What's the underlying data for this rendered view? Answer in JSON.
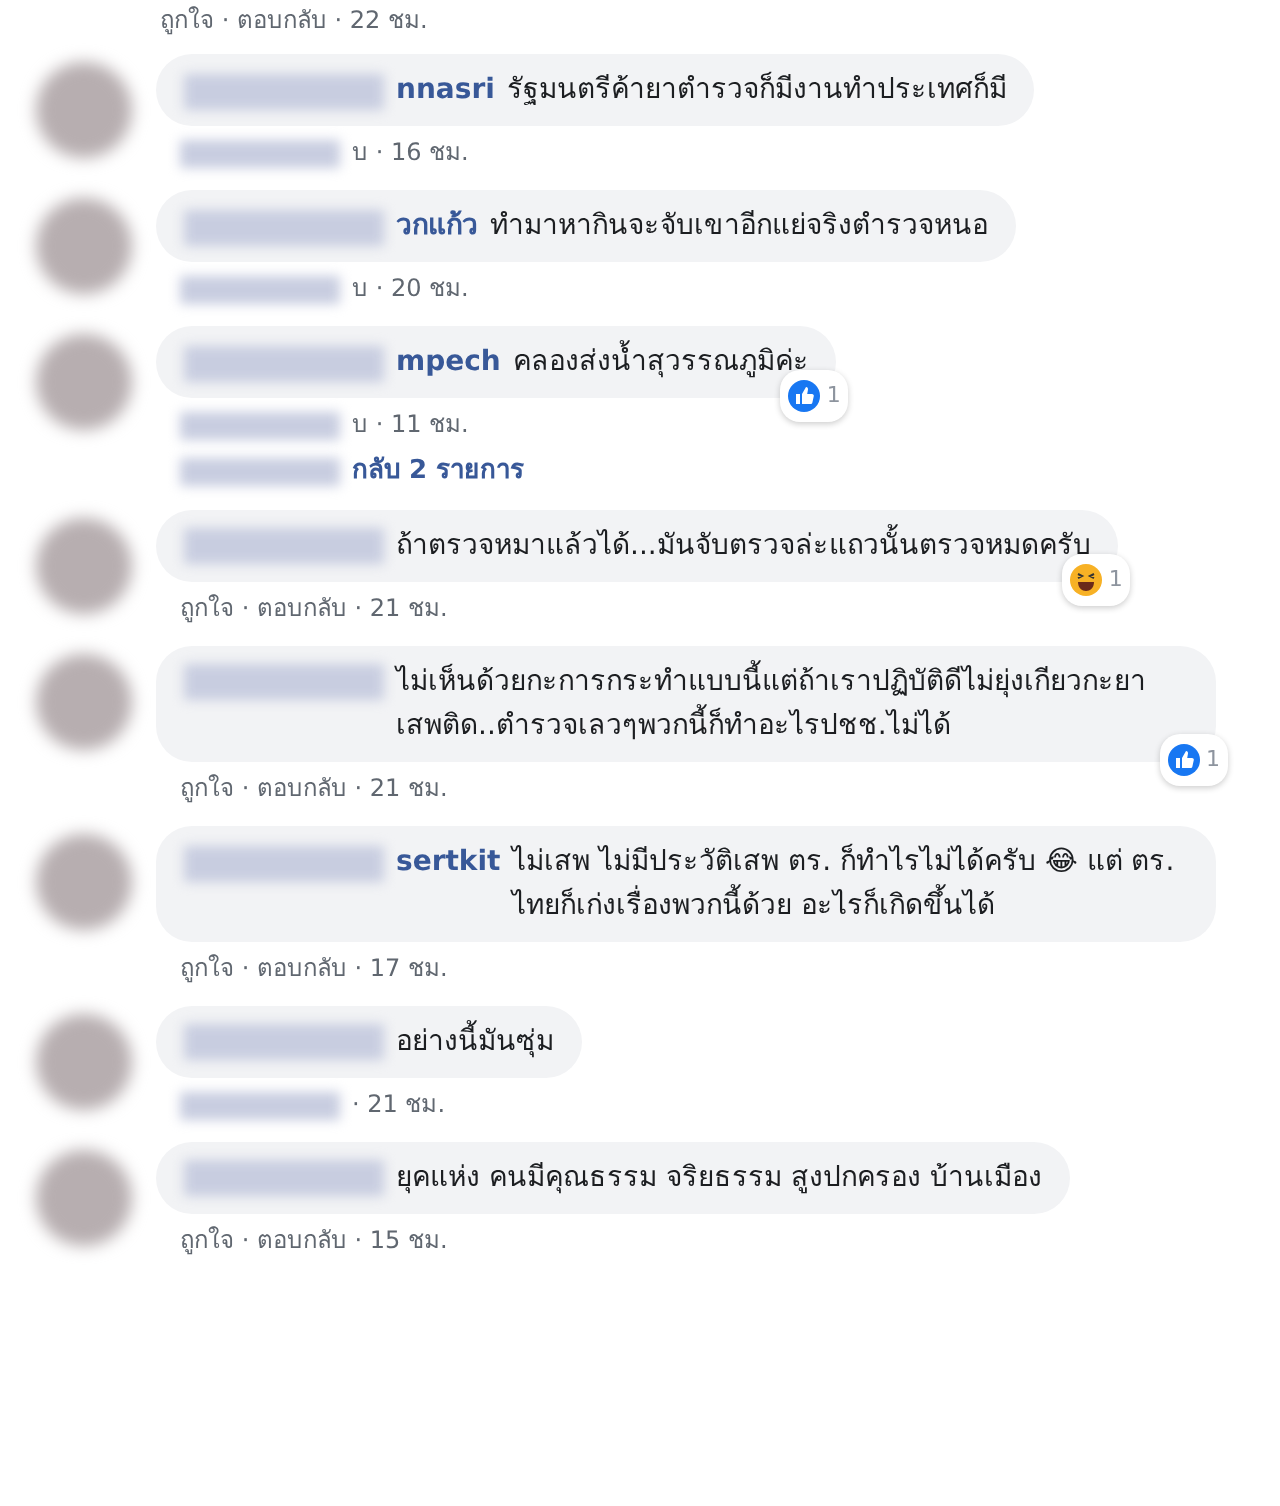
{
  "top_meta": "ถูกใจ · ตอบกลับ · 22 ชม.",
  "comments": [
    {
      "name": "nnasri",
      "text": "รัฐมนตรีค้ายาตำรวจก็มีงานทำประเทศก็มี",
      "meta": "บ · 16 ชม.",
      "meta_blurred": true
    },
    {
      "name": "วกแก้ว",
      "text": "ทำมาหากินจะจับเขาอีกแย่จริงตำรวจหนอ",
      "meta": "บ · 20 ชม.",
      "meta_blurred": true
    },
    {
      "name": "mpech",
      "text": "คลองส่งน้ำสุวรรณภูมิค่ะ",
      "meta": "บ · 11 ชม.",
      "meta_blurred": true,
      "reaction": {
        "kind": "like",
        "count": "1"
      },
      "replies": "กลับ 2 รายการ"
    },
    {
      "text": "ถ้าตรวจหมาแล้วได้...มันจับตรวจล่ะแถวนั้นตรวจหมดครับ",
      "meta": "ถูกใจ · ตอบกลับ · 21 ชม.",
      "meta_blurred": false,
      "reaction": {
        "kind": "haha",
        "count": "1"
      }
    },
    {
      "text": "ไม่เห็นด้วยกะการกระทำแบบนี้แต่ถ้าเราปฏิบัติดีไม่ยุ่งเกียวกะยาเสพติด..ตำรวจเลวๆพวกนี้ก็ทำอะไรปชช.ไม่ได้",
      "meta": "ถูกใจ · ตอบกลับ · 21 ชม.",
      "meta_blurred": false,
      "reaction": {
        "kind": "like",
        "count": "1"
      }
    },
    {
      "name": "sertkit",
      "text": "ไม่เสพ ไม่มีประวัติเสพ ตร. ก็ทำไรไม่ได้ครับ 😂 แต่ ตร. ไทยก็เก่งเรื่องพวกนี้ด้วย อะไรก็เกิดขึ้นได้",
      "meta": "ถูกใจ · ตอบกลับ · 17 ชม.",
      "meta_blurred": false
    },
    {
      "text": "อย่างนี้มันซุ่ม",
      "meta": "· 21 ชม.",
      "meta_blurred": true
    },
    {
      "text": "ยุคแห่ง คนมีคุณธรรม จริยธรรม สูงปกครอง บ้านเมือง",
      "meta": "ถูกใจ · ตอบกลับ · 15 ชม.",
      "meta_blurred": false
    }
  ]
}
